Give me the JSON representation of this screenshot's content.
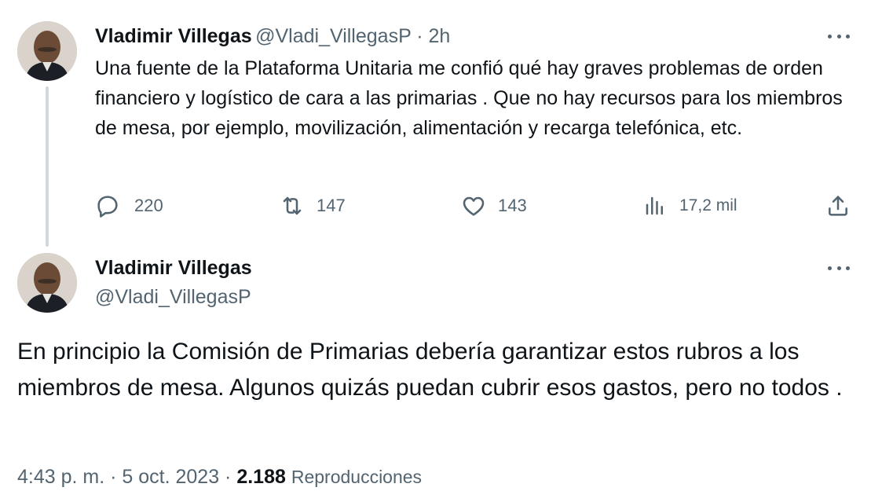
{
  "tweet1": {
    "author_name": "Vladimir Villegas",
    "handle": "@Vladi_VillegasP",
    "separator": " · ",
    "time": "2h",
    "text": "Una fuente de la Plataforma Unitaria me confió qué hay graves problemas de orden financiero y logístico de cara a las primarias . Que no hay recursos para los miembros de mesa, por ejemplo, movilización, alimentación y recarga telefónica, etc.",
    "actions": {
      "replies": "220",
      "retweets": "147",
      "likes": "143",
      "views": "17,2 mil"
    },
    "icons": [
      "reply-icon",
      "retweet-icon",
      "like-icon",
      "views-icon",
      "share-icon",
      "more-icon"
    ]
  },
  "tweet2": {
    "author_name": "Vladimir Villegas",
    "handle": "@Vladi_VillegasP",
    "text": "En principio la Comisión de Primarias debería garantizar  estos rubros a los miembros de mesa. Algunos quizás puedan cubrir esos gastos, pero no todos .",
    "time": "4:43 p. m.",
    "date": "5 oct. 2023",
    "separator": " · ",
    "views_count": "2.188",
    "views_label": "Reproducciones"
  },
  "colors": {
    "text_primary": "#0f1419",
    "text_secondary": "#536471",
    "thread_line": "#cfd9de",
    "background": "#ffffff"
  }
}
